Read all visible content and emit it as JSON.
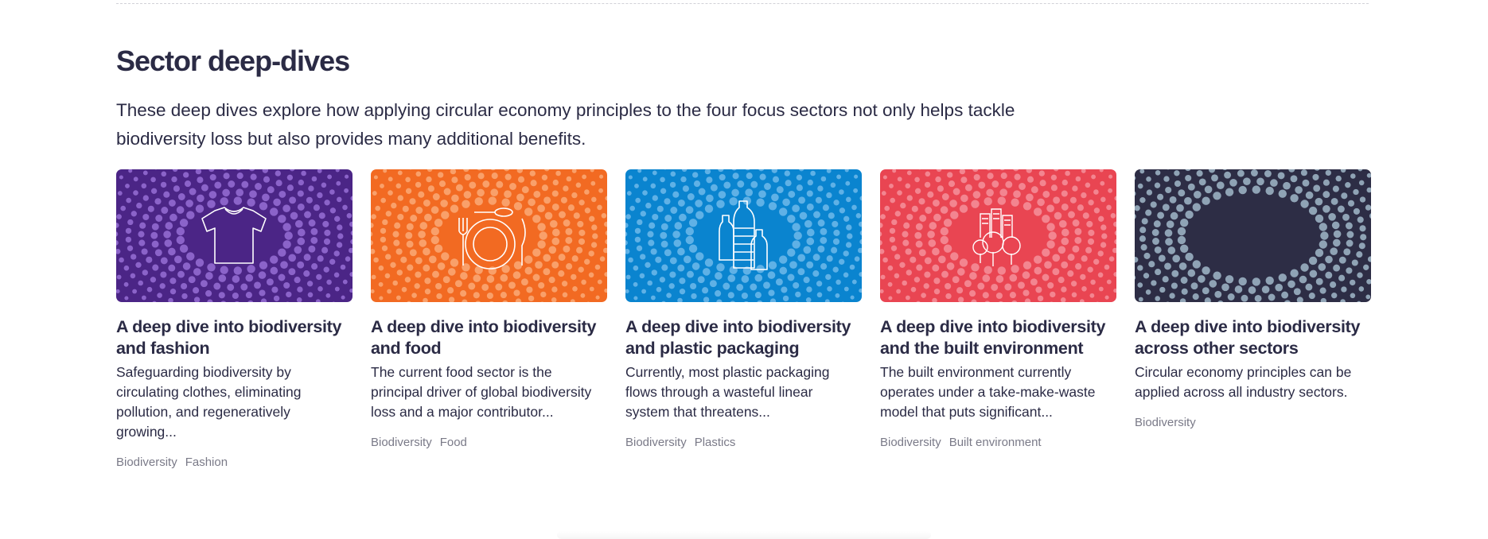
{
  "section": {
    "title": "Sector deep-dives",
    "intro": "These deep dives explore how applying circular economy principles to the four focus sectors not only helps tackle biodiversity loss but also provides many additional benefits."
  },
  "cards": [
    {
      "title": "A deep dive into biodiversity and fashion",
      "description": "Safeguarding biodiversity by circulating clothes, eliminating pollution, and regeneratively growing...",
      "tags": [
        "Biodiversity",
        "Fashion"
      ],
      "background": "#4b2586",
      "dot_color": "#8b63c9",
      "icon": "t-shirt-icon"
    },
    {
      "title": "A deep dive into biodiversity and food",
      "description": "The current food sector is the principal driver of global biodiversity loss and a major contributor...",
      "tags": [
        "Biodiversity",
        "Food"
      ],
      "background": "#f26a22",
      "dot_color": "#f9a06a",
      "icon": "plate-cutlery-icon"
    },
    {
      "title": "A deep dive into biodiversity and plastic packaging",
      "description": "Currently, most plastic packaging flows through a wasteful linear system that threatens...",
      "tags": [
        "Biodiversity",
        "Plastics"
      ],
      "background": "#0a84cf",
      "dot_color": "#5fb1e6",
      "icon": "plastic-bottles-icon"
    },
    {
      "title": "A deep dive into biodiversity and the built environment",
      "description": "The built environment currently operates under a take-make-waste model that puts significant...",
      "tags": [
        "Biodiversity",
        "Built environment"
      ],
      "background": "#e94552",
      "dot_color": "#f38590",
      "icon": "city-trees-icon"
    },
    {
      "title": "A deep dive into biodiversity across other sectors",
      "description": "Circular economy principles can be applied across all industry sectors.",
      "tags": [
        "Biodiversity"
      ],
      "background": "#2d2d45",
      "dot_color": "#8fa3b5",
      "icon": "dot-ring-icon"
    }
  ]
}
